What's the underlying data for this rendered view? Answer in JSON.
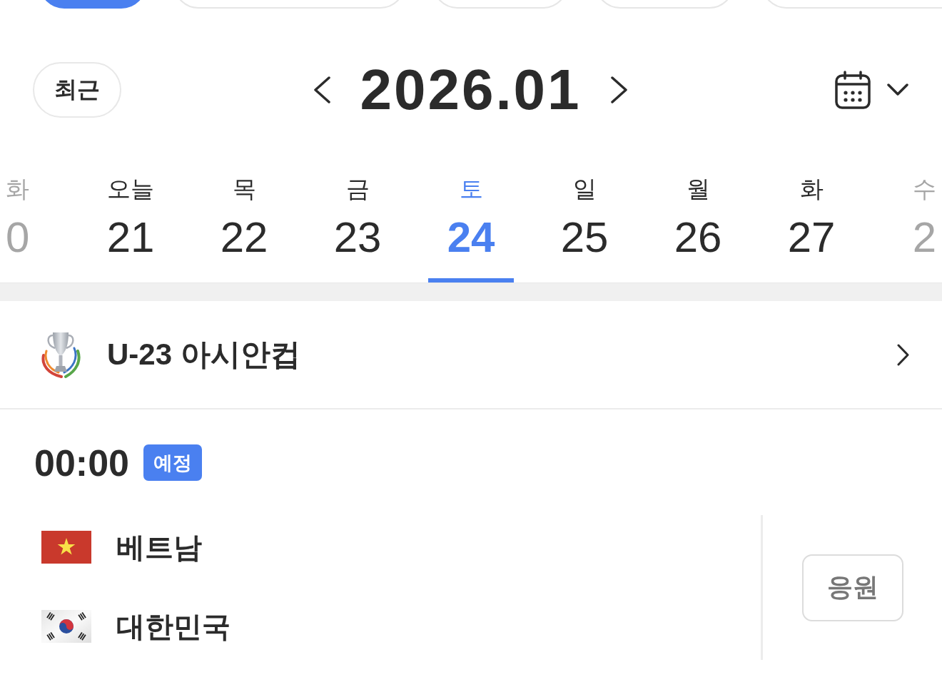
{
  "filter_chips": [
    {
      "selected": true
    },
    {
      "selected": false
    },
    {
      "selected": false
    },
    {
      "selected": false
    },
    {
      "selected": false
    }
  ],
  "header": {
    "recent_button": "최근",
    "month": "2026.01"
  },
  "days": [
    {
      "weekday": "화",
      "date": "0",
      "selected": false
    },
    {
      "weekday": "오늘",
      "date": "21",
      "selected": false
    },
    {
      "weekday": "목",
      "date": "22",
      "selected": false
    },
    {
      "weekday": "금",
      "date": "23",
      "selected": false
    },
    {
      "weekday": "토",
      "date": "24",
      "selected": true
    },
    {
      "weekday": "일",
      "date": "25",
      "selected": false
    },
    {
      "weekday": "월",
      "date": "26",
      "selected": false
    },
    {
      "weekday": "화",
      "date": "27",
      "selected": false
    },
    {
      "weekday": "수",
      "date": "2",
      "selected": false
    }
  ],
  "league": {
    "name": "U-23 아시안컵"
  },
  "matches": [
    {
      "time": "00:00",
      "status": {
        "label": "예정",
        "kind": "scheduled"
      },
      "teams": [
        {
          "name": "베트남",
          "kind": "vietnam"
        },
        {
          "name": "대한민국",
          "kind": "korea"
        }
      ],
      "cheer_button": "응원"
    }
  ]
}
